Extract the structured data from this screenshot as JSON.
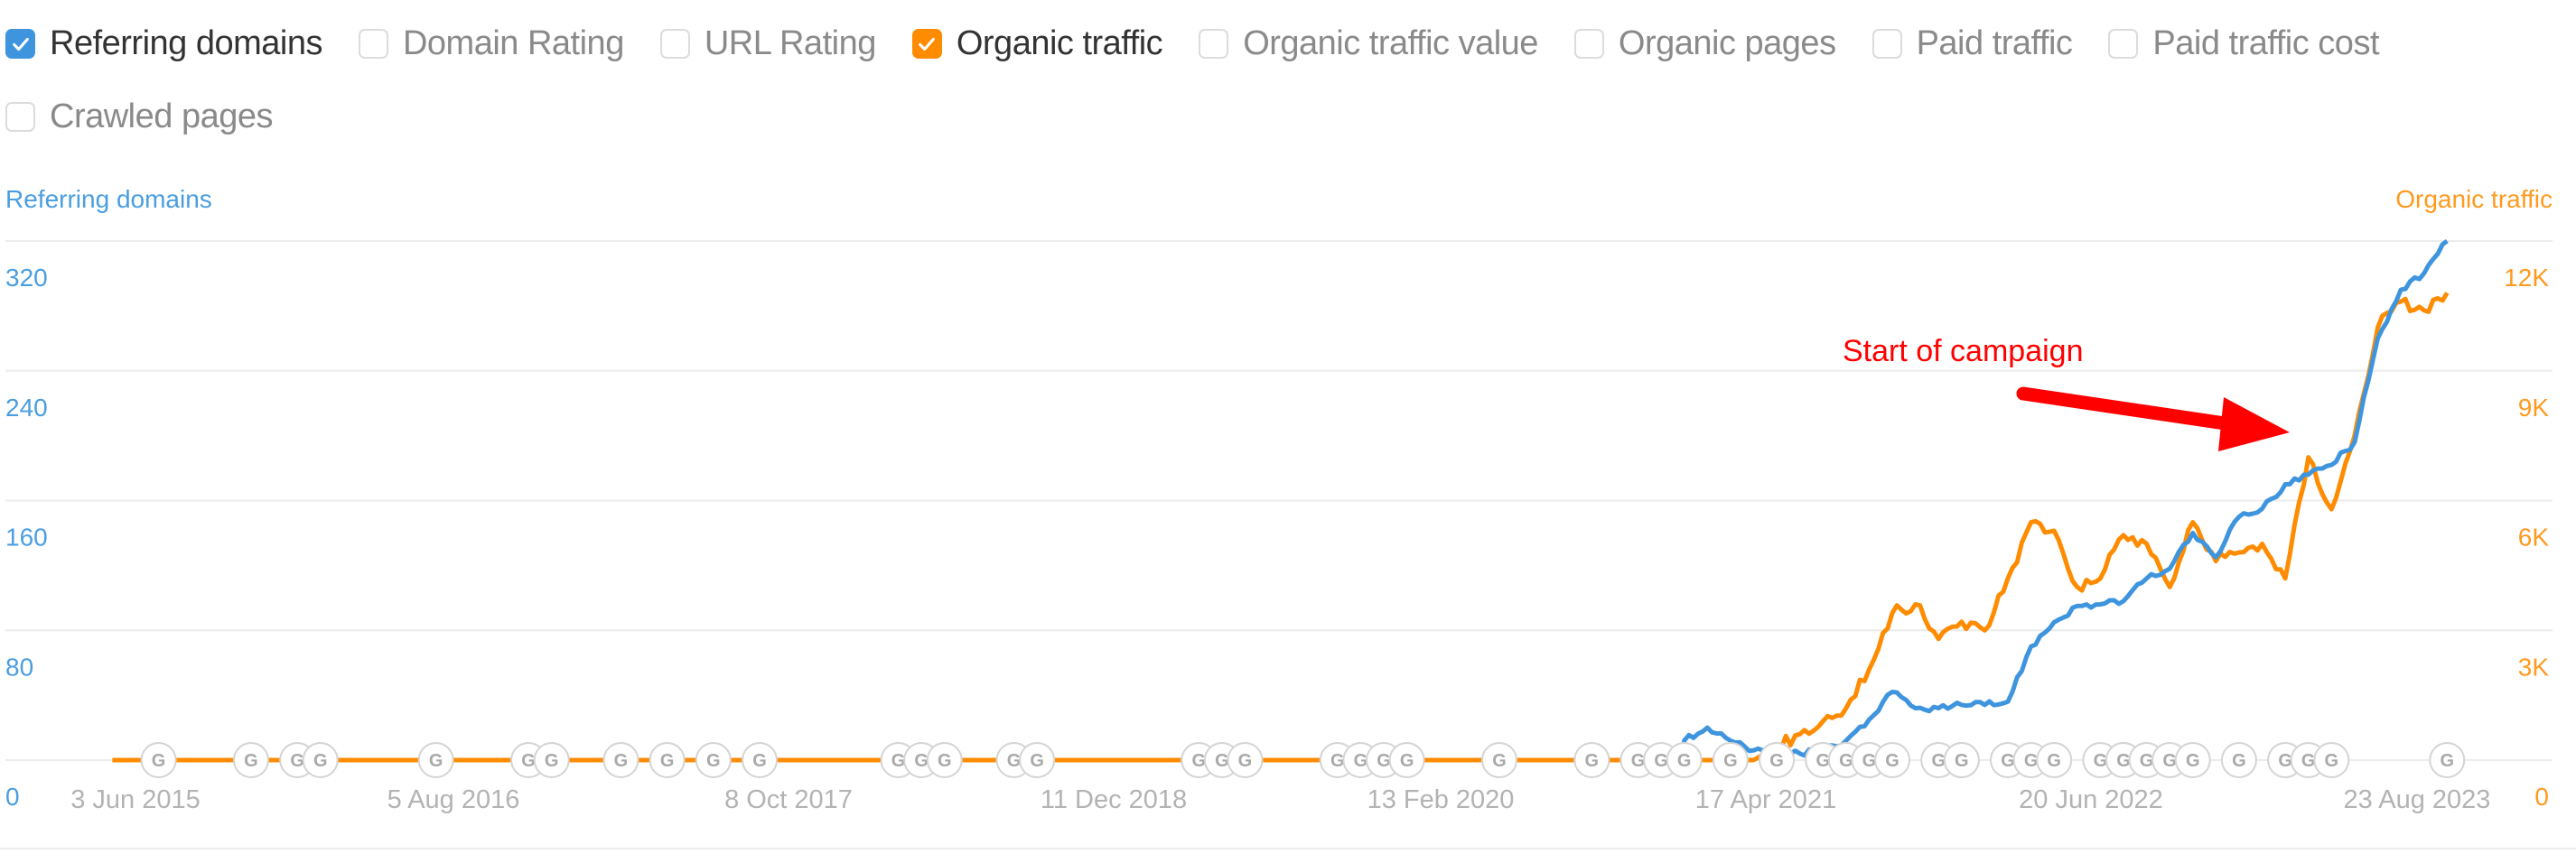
{
  "metrics": [
    {
      "label": "Referring domains",
      "checked": true,
      "color": "#3e95de"
    },
    {
      "label": "Domain Rating",
      "checked": false
    },
    {
      "label": "URL Rating",
      "checked": false
    },
    {
      "label": "Organic traffic",
      "checked": true,
      "color": "#ff8c00"
    },
    {
      "label": "Organic traffic value",
      "checked": false
    },
    {
      "label": "Organic pages",
      "checked": false
    },
    {
      "label": "Paid traffic",
      "checked": false
    },
    {
      "label": "Paid traffic cost",
      "checked": false
    },
    {
      "label": "Crawled pages",
      "checked": false
    }
  ],
  "chart_data": {
    "type": "line",
    "title": "",
    "left_axis": {
      "label": "Referring domains",
      "color": "#4a9ee0",
      "ticks": [
        "320",
        "240",
        "160",
        "80",
        "0"
      ],
      "range": [
        0,
        320
      ]
    },
    "right_axis": {
      "label": "Organic traffic",
      "color": "#ff9a1f",
      "ticks": [
        "12K",
        "9K",
        "6K",
        "3K",
        "0"
      ],
      "range": [
        0,
        12000
      ]
    },
    "x_ticks": [
      "3 Jun 2015",
      "5 Aug 2016",
      "8 Oct 2017",
      "11 Dec 2018",
      "13 Feb 2020",
      "17 Apr 2021",
      "20 Jun 2022",
      "23 Aug 2023"
    ],
    "x_range": [
      "2015-01",
      "2023-09"
    ],
    "grid": true,
    "series": [
      {
        "name": "Referring domains",
        "axis": "left",
        "color": "#3e95de",
        "points": [
          [
            "2021-01",
            0
          ],
          [
            "2021-01",
            12
          ],
          [
            "2021-02",
            20
          ],
          [
            "2021-03",
            12
          ],
          [
            "2021-04",
            6
          ],
          [
            "2021-05",
            4
          ],
          [
            "2021-06",
            4
          ],
          [
            "2021-07",
            6
          ],
          [
            "2021-08",
            12
          ],
          [
            "2021-09",
            25
          ],
          [
            "2021-10",
            42
          ],
          [
            "2021-11",
            32
          ],
          [
            "2021-12",
            32
          ],
          [
            "2022-01",
            34
          ],
          [
            "2022-02",
            34
          ],
          [
            "2022-03",
            36
          ],
          [
            "2022-04",
            70
          ],
          [
            "2022-05",
            85
          ],
          [
            "2022-06",
            95
          ],
          [
            "2022-07",
            96
          ],
          [
            "2022-08",
            98
          ],
          [
            "2022-09",
            112
          ],
          [
            "2022-10",
            118
          ],
          [
            "2022-11",
            140
          ],
          [
            "2022-12",
            125
          ],
          [
            "2023-01",
            150
          ],
          [
            "2023-02",
            155
          ],
          [
            "2023-03",
            170
          ],
          [
            "2023-04",
            176
          ],
          [
            "2023-05",
            182
          ],
          [
            "2023-06",
            196
          ],
          [
            "2023-07",
            260
          ],
          [
            "2023-08",
            290
          ],
          [
            "2023-09",
            300
          ],
          [
            "2023-10",
            320
          ]
        ]
      },
      {
        "name": "Organic traffic",
        "axis": "right",
        "color": "#ff8c00",
        "points": [
          [
            "2015-05",
            0
          ],
          [
            "2021-04",
            0
          ],
          [
            "2021-05",
            300
          ],
          [
            "2021-06",
            600
          ],
          [
            "2021-07",
            900
          ],
          [
            "2021-08",
            1200
          ],
          [
            "2021-09",
            2100
          ],
          [
            "2021-10",
            3400
          ],
          [
            "2021-11",
            3600
          ],
          [
            "2021-12",
            2800
          ],
          [
            "2022-01",
            3200
          ],
          [
            "2022-02",
            3000
          ],
          [
            "2022-03",
            4200
          ],
          [
            "2022-04",
            5500
          ],
          [
            "2022-05",
            5300
          ],
          [
            "2022-06",
            4000
          ],
          [
            "2022-07",
            4200
          ],
          [
            "2022-08",
            5200
          ],
          [
            "2022-09",
            5000
          ],
          [
            "2022-10",
            4000
          ],
          [
            "2022-11",
            5500
          ],
          [
            "2022-12",
            4600
          ],
          [
            "2023-01",
            4800
          ],
          [
            "2023-02",
            5000
          ],
          [
            "2023-03",
            4200
          ],
          [
            "2023-04",
            7000
          ],
          [
            "2023-05",
            5800
          ],
          [
            "2023-06",
            7500
          ],
          [
            "2023-07",
            10000
          ],
          [
            "2023-08",
            10600
          ],
          [
            "2023-09",
            10400
          ],
          [
            "2023-10",
            10800
          ]
        ]
      }
    ],
    "annotations": [
      {
        "text": "Start of campaign",
        "color": "#ff0000",
        "points_to": "2023-06"
      }
    ],
    "event_markers": {
      "label": "G",
      "description": "Google algorithm update markers along x-axis",
      "dates": [
        "2015-07",
        "2015-11",
        "2016-01",
        "2016-02",
        "2016-07",
        "2016-11",
        "2016-12",
        "2017-03",
        "2017-05",
        "2017-07",
        "2017-09",
        "2018-03",
        "2018-04",
        "2018-05",
        "2018-08",
        "2018-09",
        "2019-04",
        "2019-05",
        "2019-06",
        "2019-10",
        "2019-11",
        "2019-12",
        "2020-01",
        "2020-05",
        "2020-09",
        "2020-11",
        "2020-12",
        "2021-01",
        "2021-03",
        "2021-05",
        "2021-07",
        "2021-07",
        "2021-08",
        "2021-08",
        "2021-09",
        "2021-09",
        "2021-10",
        "2021-12",
        "2022-01",
        "2022-01",
        "2022-03",
        "2022-04",
        "2022-05",
        "2022-07",
        "2022-08",
        "2022-08",
        "2022-09",
        "2022-10",
        "2022-11",
        "2023-01",
        "2023-03",
        "2023-04",
        "2023-05",
        "2023-10"
      ]
    }
  }
}
